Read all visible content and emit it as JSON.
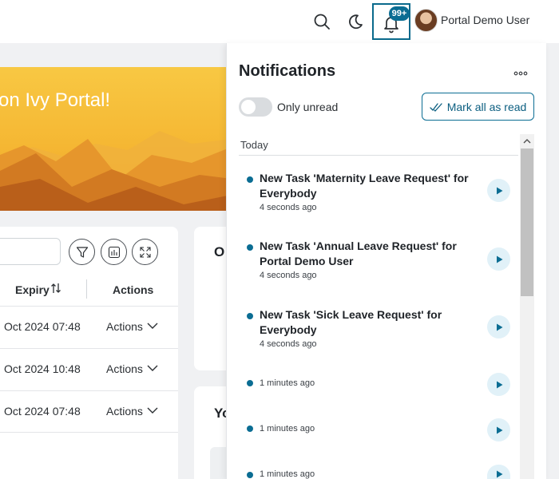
{
  "topbar": {
    "notification_badge": "99+",
    "user_name": "Portal Demo User"
  },
  "banner": {
    "welcome_text": "on Ivy Portal!"
  },
  "task_table": {
    "columns": {
      "expiry": "Expiry",
      "actions": "Actions"
    },
    "rows": [
      {
        "expiry": "Oct 2024 07:48",
        "actions": "Actions"
      },
      {
        "expiry": "Oct 2024 10:48",
        "actions": "Actions"
      },
      {
        "expiry": "Oct 2024 07:48",
        "actions": "Actions"
      }
    ]
  },
  "cards": {
    "card1_title": "O",
    "card2_title": "Yo"
  },
  "notifications": {
    "title": "Notifications",
    "only_unread_label": "Only unread",
    "only_unread_on": false,
    "mark_all_label": "Mark all as read",
    "group_label": "Today",
    "items": [
      {
        "title": "New Task 'Maternity Leave Request' for Everybody",
        "time": "4 seconds ago"
      },
      {
        "title": "New Task 'Annual Leave Request' for Portal Demo User",
        "time": "4 seconds ago"
      },
      {
        "title": "New Task 'Sick Leave Request' for Everybody",
        "time": "4 seconds ago"
      },
      {
        "title": "",
        "time": "1 minutes ago"
      },
      {
        "title": "",
        "time": "1 minutes ago"
      },
      {
        "title": "",
        "time": "1 minutes ago"
      }
    ]
  },
  "colors": {
    "accent": "#0b6d93",
    "banner_yellow": "#f5b733",
    "unread_dot": "#0b6d93"
  }
}
